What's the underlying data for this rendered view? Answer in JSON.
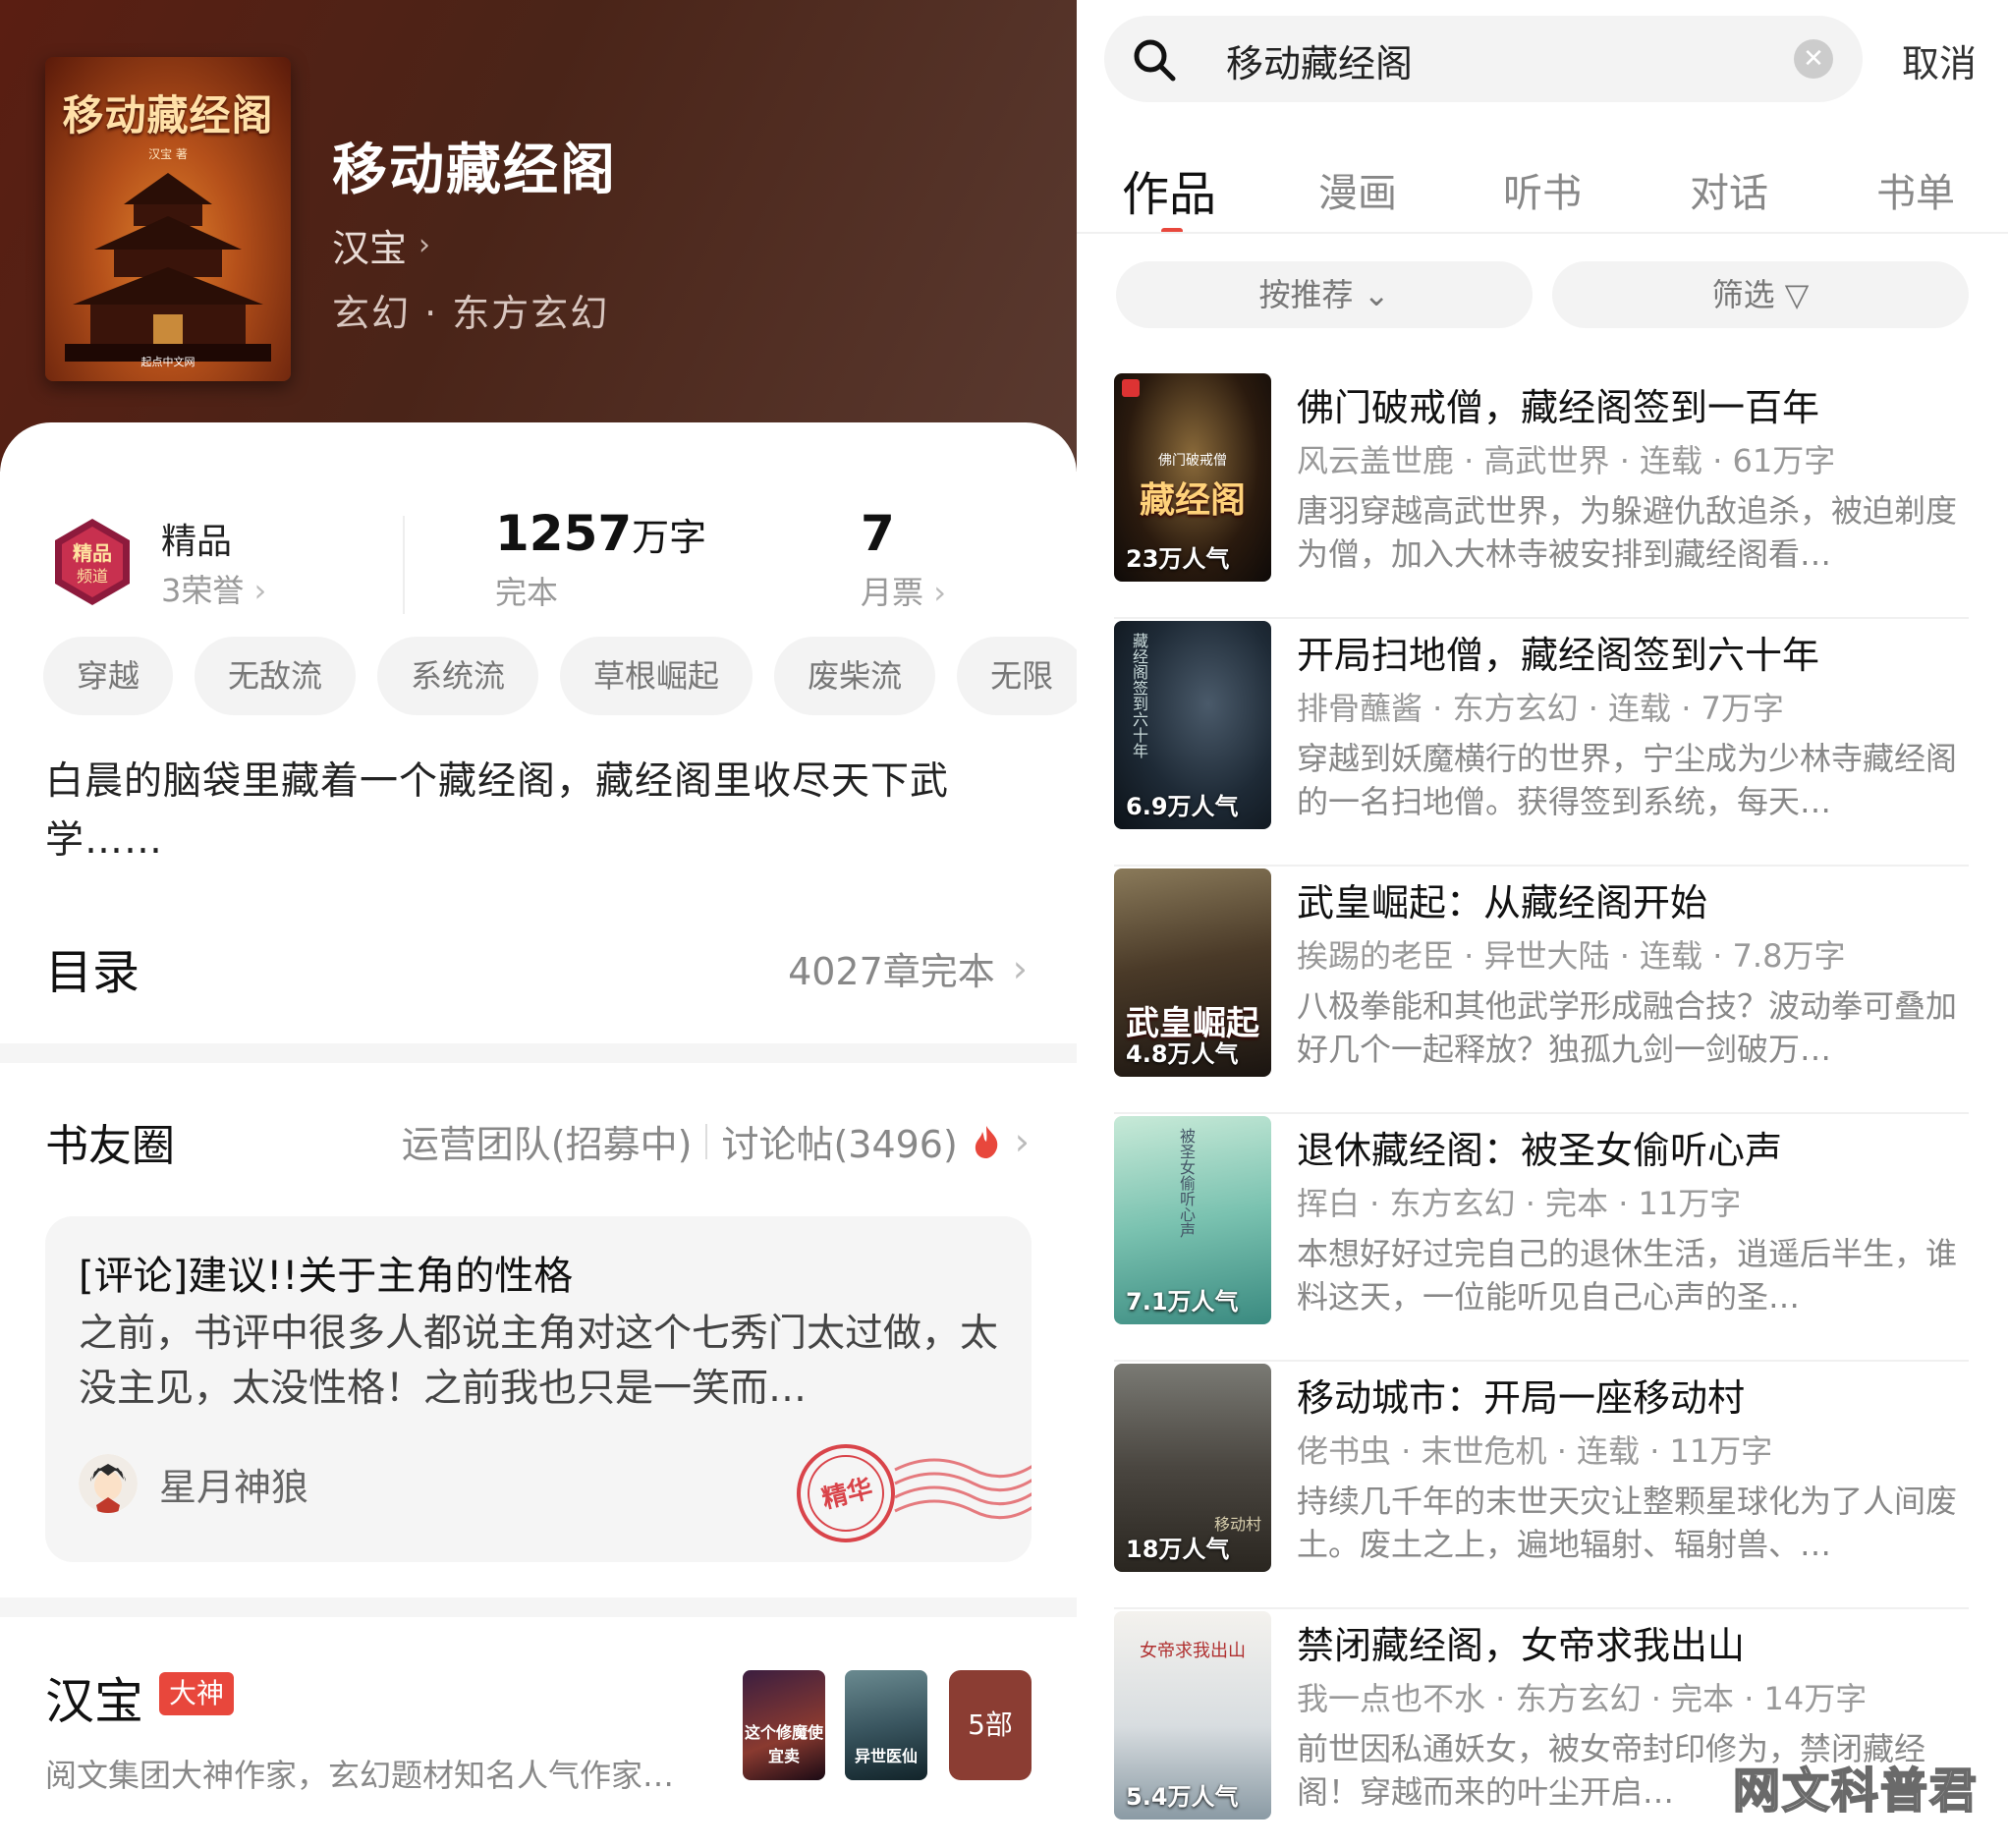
{
  "book": {
    "title": "移动藏经阁",
    "author": "汉宝",
    "genre": "玄幻 · 东方玄幻",
    "cover_title": "移动藏经阁",
    "cover_author": "汉宝 著",
    "cover_publisher": "起点中文网"
  },
  "stats": {
    "level": "精品",
    "honors": "3荣誉",
    "words_num": "1257",
    "words_unit": "万字",
    "status": "完本",
    "votes": "7",
    "votes_label": "月票"
  },
  "tags": [
    "穿越",
    "无敌流",
    "系统流",
    "草根崛起",
    "废柴流",
    "无限"
  ],
  "description": "白晨的脑袋里藏着一个藏经阁，藏经阁里收尽天下武学……",
  "toc": {
    "title": "目录",
    "info": "4027章完本"
  },
  "circle": {
    "title": "书友圈",
    "team": "运营团队(招募中)",
    "posts": "讨论帖(3496)",
    "post": {
      "title": "[评论]建议!!关于主角的性格",
      "body": "之前，书评中很多人都说主角对这个七秀门太过做，太没主见，太没性格！之前我也只是一笑而…",
      "user": "星月神狼",
      "stamp": "精华"
    }
  },
  "author": {
    "name": "汉宝",
    "badge": "大神",
    "desc": "阅文集团大神作家，玄幻题材知名人气作家…",
    "works": [
      {
        "title": "这个修魔使宜卖"
      },
      {
        "title": "异世医仙"
      }
    ],
    "more": "5部"
  },
  "search": {
    "value": "移动藏经阁",
    "cancel": "取消"
  },
  "tabs": [
    "作品",
    "漫画",
    "听书",
    "对话",
    "书单"
  ],
  "filters": {
    "sort": "按推荐",
    "filter": "筛选"
  },
  "results": [
    {
      "title": "佛门破戒僧，藏经阁签到一百年",
      "meta": "风云盖世鹿 · 高武世界 · 连载 · 61万字",
      "desc": "唐羽穿越高武世界，为躲避仇敌追杀，被迫剃度为僧，加入大林寺被安排到藏经阁看…",
      "pop": "23万人气",
      "cover_text": "藏经阁",
      "cover_top": "佛门破戒僧"
    },
    {
      "title": "开局扫地僧，藏经阁签到六十年",
      "meta": "排骨蘸酱 · 东方玄幻 · 连载 · 7万字",
      "desc": "穿越到妖魔横行的世界，宁尘成为少林寺藏经阁的一名扫地僧。获得签到系统，每天…",
      "pop": "6.9万人气",
      "cover_text": "",
      "cover_top": "藏经阁签到六十年"
    },
    {
      "title": "武皇崛起：从藏经阁开始",
      "meta": "挨踢的老臣 · 异世大陆 · 连载 · 7.8万字",
      "desc": "八极拳能和其他武学形成融合技？波动拳可叠加好几个一起释放？独孤九剑一剑破万…",
      "pop": "4.8万人气",
      "cover_text": "武皇崛起",
      "cover_top": ""
    },
    {
      "title": "退休藏经阁：被圣女偷听心声",
      "meta": "挥白 · 东方玄幻 · 完本 · 11万字",
      "desc": "本想好好过完自己的退休生活，逍遥后半生，谁料这天，一位能听见自己心声的圣…",
      "pop": "7.1万人气",
      "cover_text": "",
      "cover_top": "被圣女偷听心声"
    },
    {
      "title": "移动城市：开局一座移动村",
      "meta": "佬书虫 · 末世危机 · 连载 · 11万字",
      "desc": "持续几千年的末世天灾让整颗星球化为了人间废土。废土之上，遍地辐射、辐射兽、…",
      "pop": "18万人气",
      "cover_text": "",
      "cover_top": "移动村"
    },
    {
      "title": "禁闭藏经阁，女帝求我出山",
      "meta": "我一点也不水 · 东方玄幻 · 完本 · 14万字",
      "desc": "前世因私通妖女，被女帝封印修为，禁闭藏经阁！穿越而来的叶尘开启…",
      "pop": "5.4万人气",
      "cover_text": "",
      "cover_top": "女帝求我出山"
    }
  ],
  "watermark": "网文科普君",
  "colors": {
    "accent": "#e8473c",
    "hero": "#5a2418"
  }
}
